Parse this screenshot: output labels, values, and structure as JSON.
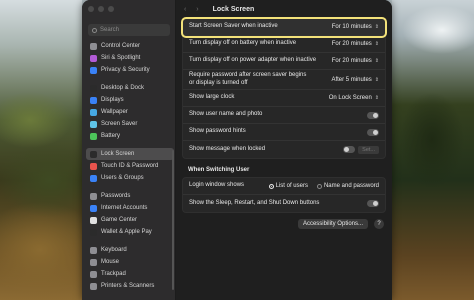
{
  "window": {
    "title": "Lock Screen",
    "nav_arrows": "‹ ›"
  },
  "search": {
    "placeholder": "Search"
  },
  "sidebar": {
    "items": [
      {
        "label": "Control Center",
        "color": "#8e8e93"
      },
      {
        "label": "Siri & Spotlight",
        "color": "#b25bd6"
      },
      {
        "label": "Privacy & Security",
        "color": "#3a82f7"
      },
      {
        "label": "Desktop & Dock",
        "color": "#2b2b2b"
      },
      {
        "label": "Displays",
        "color": "#3a82f7"
      },
      {
        "label": "Wallpaper",
        "color": "#46a8e3"
      },
      {
        "label": "Screen Saver",
        "color": "#5fc4e8"
      },
      {
        "label": "Battery",
        "color": "#4cc35a"
      },
      {
        "label": "Lock Screen",
        "color": "#2b2b2b",
        "active": true
      },
      {
        "label": "Touch ID & Password",
        "color": "#e8534d"
      },
      {
        "label": "Users & Groups",
        "color": "#3a82f7"
      },
      {
        "label": "Passwords",
        "color": "#8e8e93"
      },
      {
        "label": "Internet Accounts",
        "color": "#3a82f7"
      },
      {
        "label": "Game Center",
        "color": "#e0e0e0"
      },
      {
        "label": "Wallet & Apple Pay",
        "color": "#2b2b2b"
      },
      {
        "label": "Keyboard",
        "color": "#8e8e93"
      },
      {
        "label": "Mouse",
        "color": "#8e8e93"
      },
      {
        "label": "Trackpad",
        "color": "#8e8e93"
      },
      {
        "label": "Printers & Scanners",
        "color": "#8e8e93"
      }
    ]
  },
  "settings": {
    "screen_saver": {
      "label": "Start Screen Saver when inactive",
      "value": "For 10 minutes"
    },
    "display_off_battery": {
      "label": "Turn display off on battery when inactive",
      "value": "For 20 minutes"
    },
    "display_off_power": {
      "label": "Turn display off on power adapter when inactive",
      "value": "For 20 minutes"
    },
    "require_password": {
      "label": "Require password after screen saver begins or display is turned off",
      "value": "After 5 minutes"
    },
    "large_clock": {
      "label": "Show large clock",
      "value": "On Lock Screen"
    },
    "user_name_photo": {
      "label": "Show user name and photo",
      "on": true
    },
    "password_hints": {
      "label": "Show password hints",
      "on": true
    },
    "message_locked": {
      "label": "Show message when locked",
      "on": false,
      "button": "Set..."
    }
  },
  "switching_user": {
    "title": "When Switching User",
    "login_window": {
      "label": "Login window shows",
      "option_a": "List of users",
      "option_b": "Name and password",
      "selected": "List of users"
    },
    "sleep_restart": {
      "label": "Show the Sleep, Restart, and Shut Down buttons",
      "on": true
    }
  },
  "footer": {
    "accessibility_button": "Accessibility Options...",
    "help": "?"
  },
  "icons": {
    "chevron": "updown-chevron-icon",
    "search": "magnifier-icon"
  }
}
